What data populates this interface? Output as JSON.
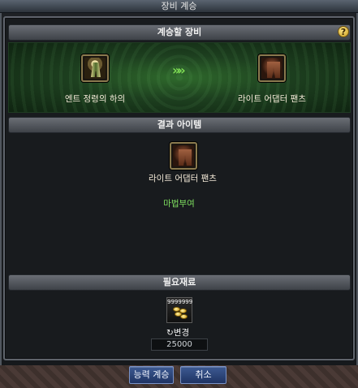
{
  "window": {
    "title": "장비 계승"
  },
  "sections": {
    "inherit_equipment": "계승할 장비",
    "result_item": "결과 아이템",
    "required_materials": "필요재료"
  },
  "help_icon_text": "?",
  "source_item": {
    "name": "엔트 정령의 하의",
    "icon": "skirt-icon"
  },
  "target_item": {
    "name": "라이트 어댑터 팬츠",
    "icon": "pants-icon"
  },
  "transfer_arrow": "»»",
  "result_item": {
    "name": "라이트 어댑터 팬츠",
    "icon": "pants-icon",
    "enchant_text": "마법부여"
  },
  "material": {
    "count": "9999999",
    "icon": "gold-coins-icon",
    "change_label": "↻변경",
    "cost": "25000"
  },
  "buttons": {
    "inherit": "능력 계승",
    "cancel": "취소"
  },
  "colors": {
    "accent_green": "#7fe060",
    "button_blue": "#2b4478",
    "gold": "#d39c18"
  }
}
